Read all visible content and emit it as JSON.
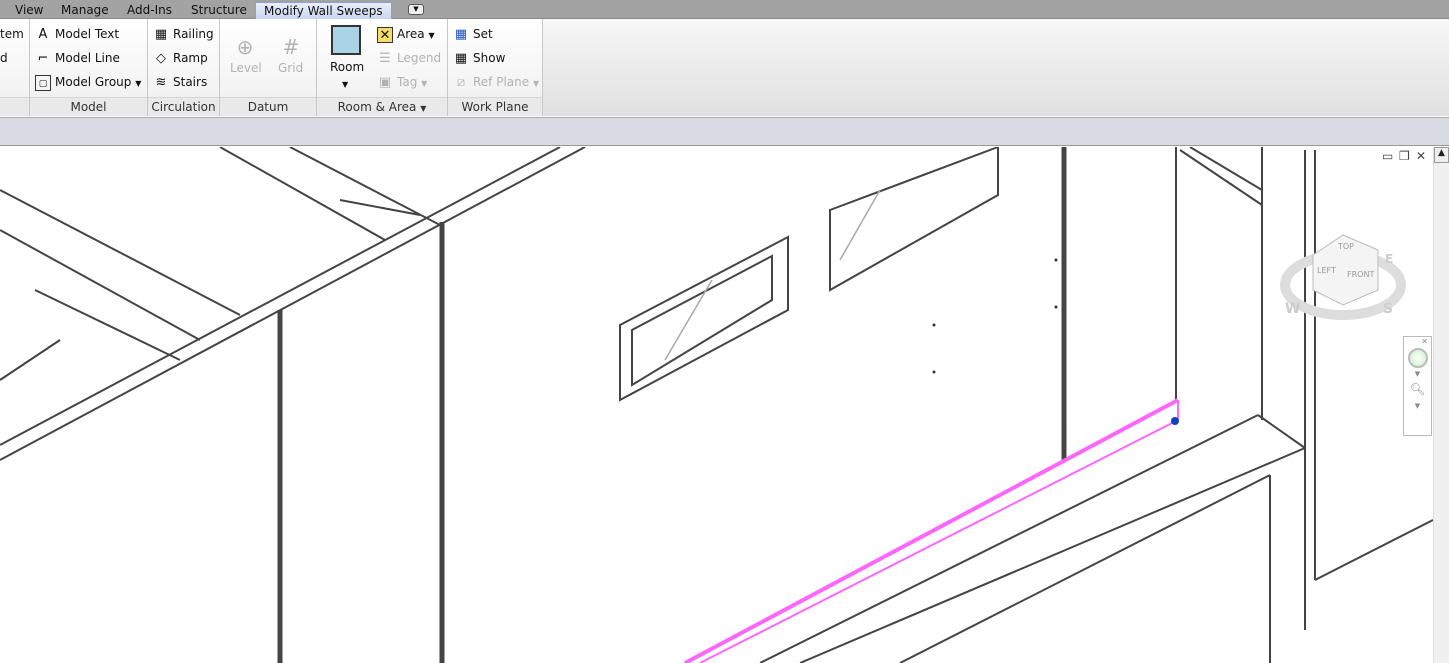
{
  "tabs": [
    "View",
    "Manage",
    "Add-Ins",
    "Structure",
    "Modify Wall Sweeps"
  ],
  "ribbon": {
    "cut_left": [
      "tem",
      "d"
    ],
    "model": {
      "label": "Model",
      "items": [
        "Model Text",
        "Model Line",
        "Model Group"
      ]
    },
    "circulation": {
      "label": "Circulation",
      "items": [
        "Railing",
        "Ramp",
        "Stairs"
      ]
    },
    "datum": {
      "label": "Datum",
      "items": [
        "Level",
        "Grid"
      ]
    },
    "room_area": {
      "label": "Room & Area",
      "room": "Room",
      "items": [
        "Area",
        "Legend",
        "Tag"
      ]
    },
    "work_plane": {
      "label": "Work Plane",
      "items": [
        "Set",
        "Show",
        "Ref Plane"
      ]
    }
  },
  "viewcube": {
    "top": "TOP",
    "left": "LEFT",
    "front": "FRONT",
    "compass": [
      "W",
      "E",
      "S"
    ]
  },
  "colors": {
    "selection": "#ff66ff",
    "grip": "#1040c0"
  }
}
